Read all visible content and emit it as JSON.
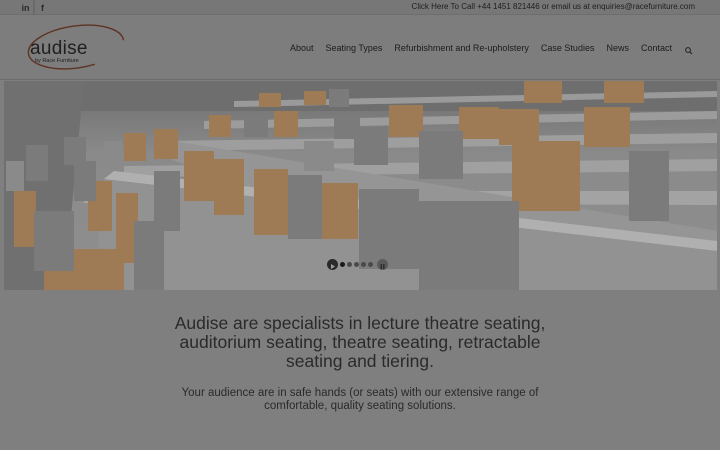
{
  "topbar": {
    "social": [
      {
        "name": "linkedin-icon",
        "glyph": "in"
      },
      {
        "name": "facebook-icon",
        "glyph": "f"
      }
    ],
    "contact_text": "Click Here To Call +44 1451 821446 or email us at enquiries@racefurniture.com"
  },
  "logo": {
    "word": "audise",
    "sub": "by Race Furniture",
    "accent_color": "#b5502a"
  },
  "nav": {
    "items": [
      "About",
      "Seating Types",
      "Refurbishment and Re-upholstery",
      "Case Studies",
      "News",
      "Contact"
    ],
    "search_icon": "search-icon"
  },
  "slider": {
    "slide_count": 5,
    "active_index": 0,
    "play_icon": "play-icon",
    "pause_icon": "pause-icon"
  },
  "intro": {
    "headline": "Audise are specialists in lecture theatre seating, auditorium seating, theatre seating, retractable seating and tiering.",
    "subline": "Your audience are in safe hands (or seats) with our extensive range of comfortable, quality seating solutions."
  }
}
